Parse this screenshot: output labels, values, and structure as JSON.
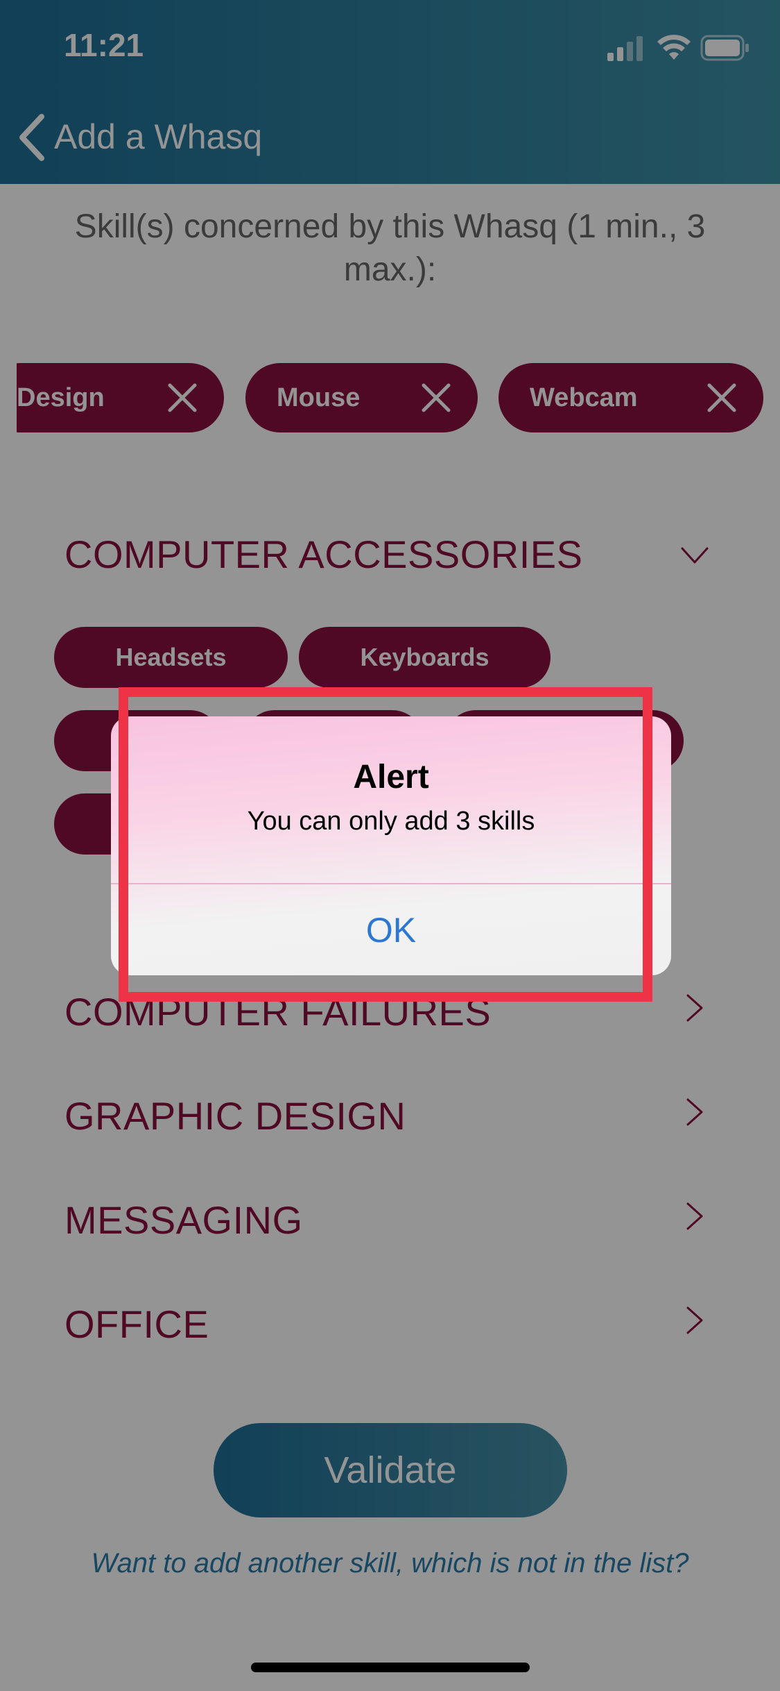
{
  "status_bar": {
    "time": "11:21"
  },
  "nav": {
    "title": "Add a Whasq"
  },
  "skills_heading": "Skill(s) concerned by this Whasq (1 min., 3 max.):",
  "selected_skills": [
    {
      "label": "Design"
    },
    {
      "label": "Mouse"
    },
    {
      "label": "Webcam"
    }
  ],
  "categories": [
    {
      "label": "COMPUTER ACCESSORIES",
      "expanded": true
    },
    {
      "label": "COMPUTER FAILURES",
      "expanded": false
    },
    {
      "label": "GRAPHIC DESIGN",
      "expanded": false
    },
    {
      "label": "MESSAGING",
      "expanded": false
    },
    {
      "label": "OFFICE",
      "expanded": false
    }
  ],
  "accessory_skills": [
    "Headsets",
    "Keyboards"
  ],
  "validate_label": "Validate",
  "add_skill_link": "Want to add another skill, which is not in the list?",
  "alert": {
    "title": "Alert",
    "message": "You can only add 3 skills",
    "ok_label": "OK"
  },
  "colors": {
    "accent": "#8a1041",
    "header_gradient_start": "#1e6f96",
    "header_gradient_end": "#3f8fa6",
    "highlight": "#ee3346",
    "link": "#2b77d1"
  }
}
